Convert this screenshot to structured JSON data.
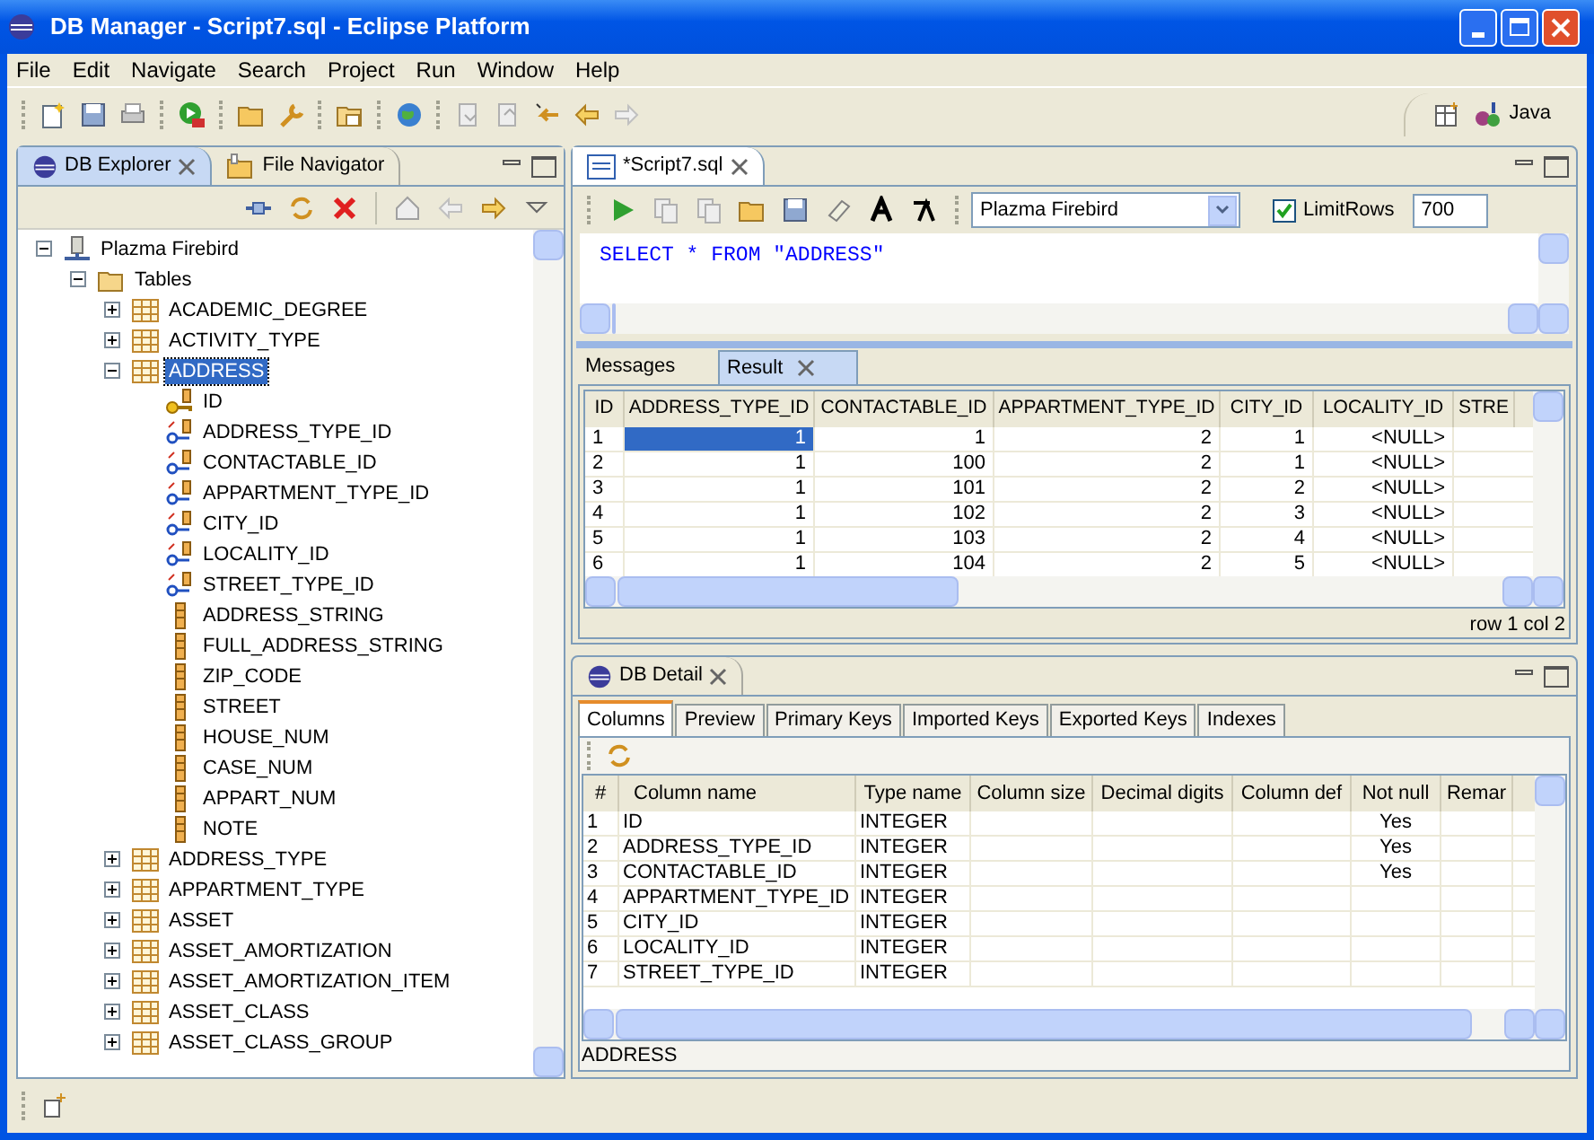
{
  "window": {
    "title": "DB Manager - Script7.sql - Eclipse Platform"
  },
  "menu": [
    "File",
    "Edit",
    "Navigate",
    "Search",
    "Project",
    "Run",
    "Window",
    "Help"
  ],
  "perspective": {
    "label": "Java"
  },
  "left_view": {
    "tabs": [
      {
        "label": "DB Explorer",
        "selected": true
      },
      {
        "label": "File Navigator",
        "selected": false
      }
    ],
    "tree": [
      {
        "label": "Plazma Firebird",
        "kind": "connection",
        "expanded": true,
        "selected": false,
        "children": [
          {
            "label": "Tables",
            "kind": "folder",
            "expanded": true,
            "selected": false,
            "children": [
              {
                "label": "ACADEMIC_DEGREE",
                "kind": "table",
                "expanded": false,
                "selected": false
              },
              {
                "label": "ACTIVITY_TYPE",
                "kind": "table",
                "expanded": false,
                "selected": false
              },
              {
                "label": "ADDRESS",
                "kind": "table",
                "expanded": true,
                "selected": true,
                "children": [
                  {
                    "label": "ID",
                    "kind": "primary_key",
                    "selected": false
                  },
                  {
                    "label": "ADDRESS_TYPE_ID",
                    "kind": "foreign_key",
                    "selected": false
                  },
                  {
                    "label": "CONTACTABLE_ID",
                    "kind": "foreign_key",
                    "selected": false
                  },
                  {
                    "label": "APPARTMENT_TYPE_ID",
                    "kind": "foreign_key",
                    "selected": false
                  },
                  {
                    "label": "CITY_ID",
                    "kind": "foreign_key",
                    "selected": false
                  },
                  {
                    "label": "LOCALITY_ID",
                    "kind": "foreign_key",
                    "selected": false
                  },
                  {
                    "label": "STREET_TYPE_ID",
                    "kind": "foreign_key",
                    "selected": false
                  },
                  {
                    "label": "ADDRESS_STRING",
                    "kind": "column",
                    "selected": false
                  },
                  {
                    "label": "FULL_ADDRESS_STRING",
                    "kind": "column",
                    "selected": false
                  },
                  {
                    "label": "ZIP_CODE",
                    "kind": "column",
                    "selected": false
                  },
                  {
                    "label": "STREET",
                    "kind": "column",
                    "selected": false
                  },
                  {
                    "label": "HOUSE_NUM",
                    "kind": "column",
                    "selected": false
                  },
                  {
                    "label": "CASE_NUM",
                    "kind": "column",
                    "selected": false
                  },
                  {
                    "label": "APPART_NUM",
                    "kind": "column",
                    "selected": false
                  },
                  {
                    "label": "NOTE",
                    "kind": "column",
                    "selected": false
                  }
                ]
              },
              {
                "label": "ADDRESS_TYPE",
                "kind": "table",
                "expanded": false,
                "selected": false
              },
              {
                "label": "APPARTMENT_TYPE",
                "kind": "table",
                "expanded": false,
                "selected": false
              },
              {
                "label": "ASSET",
                "kind": "table",
                "expanded": false,
                "selected": false
              },
              {
                "label": "ASSET_AMORTIZATION",
                "kind": "table",
                "expanded": false,
                "selected": false
              },
              {
                "label": "ASSET_AMORTIZATION_ITEM",
                "kind": "table",
                "expanded": false,
                "selected": false
              },
              {
                "label": "ASSET_CLASS",
                "kind": "table",
                "expanded": false,
                "selected": false
              },
              {
                "label": "ASSET_CLASS_GROUP",
                "kind": "table",
                "expanded": false,
                "selected": false
              }
            ]
          }
        ]
      }
    ]
  },
  "editor": {
    "tab": {
      "label": "*Script7.sql"
    },
    "connection": {
      "value": "Plazma Firebird"
    },
    "limit_rows": {
      "label": "LimitRows",
      "checked": true,
      "value": "700"
    },
    "sql": "SELECT * FROM \"ADDRESS\"",
    "result_tabs": [
      {
        "label": "Messages",
        "selected": false,
        "closable": false
      },
      {
        "label": "Result",
        "selected": true,
        "closable": true
      }
    ],
    "result_table": {
      "columns": [
        "ID",
        "ADDRESS_TYPE_ID",
        "CONTACTABLE_ID",
        "APPARTMENT_TYPE_ID",
        "CITY_ID",
        "LOCALITY_ID",
        "STRE"
      ],
      "rows": [
        [
          {
            "text": "1",
            "selected": false
          },
          {
            "text": "1",
            "selected": true
          },
          {
            "text": "1",
            "selected": false
          },
          {
            "text": "2",
            "selected": false
          },
          {
            "text": "1",
            "selected": false
          },
          {
            "text": "<NULL>",
            "selected": false
          }
        ],
        [
          {
            "text": "2",
            "selected": false
          },
          {
            "text": "1",
            "selected": false
          },
          {
            "text": "100",
            "selected": false
          },
          {
            "text": "2",
            "selected": false
          },
          {
            "text": "1",
            "selected": false
          },
          {
            "text": "<NULL>",
            "selected": false
          }
        ],
        [
          {
            "text": "3",
            "selected": false
          },
          {
            "text": "1",
            "selected": false
          },
          {
            "text": "101",
            "selected": false
          },
          {
            "text": "2",
            "selected": false
          },
          {
            "text": "2",
            "selected": false
          },
          {
            "text": "<NULL>",
            "selected": false
          }
        ],
        [
          {
            "text": "4",
            "selected": false
          },
          {
            "text": "1",
            "selected": false
          },
          {
            "text": "102",
            "selected": false
          },
          {
            "text": "2",
            "selected": false
          },
          {
            "text": "3",
            "selected": false
          },
          {
            "text": "<NULL>",
            "selected": false
          }
        ],
        [
          {
            "text": "5",
            "selected": false
          },
          {
            "text": "1",
            "selected": false
          },
          {
            "text": "103",
            "selected": false
          },
          {
            "text": "2",
            "selected": false
          },
          {
            "text": "4",
            "selected": false
          },
          {
            "text": "<NULL>",
            "selected": false
          }
        ],
        [
          {
            "text": "6",
            "selected": false
          },
          {
            "text": "1",
            "selected": false
          },
          {
            "text": "104",
            "selected": false
          },
          {
            "text": "2",
            "selected": false
          },
          {
            "text": "5",
            "selected": false
          },
          {
            "text": "<NULL>",
            "selected": false
          }
        ]
      ]
    },
    "status": "row 1 col 2"
  },
  "detail": {
    "tab": {
      "label": "DB Detail"
    },
    "tabs": [
      {
        "label": "Columns",
        "selected": true
      },
      {
        "label": "Preview",
        "selected": false
      },
      {
        "label": "Primary Keys",
        "selected": false
      },
      {
        "label": "Imported Keys",
        "selected": false
      },
      {
        "label": "Exported Keys",
        "selected": false
      },
      {
        "label": "Indexes",
        "selected": false
      }
    ],
    "columns": [
      "#",
      "Column name",
      "Type name",
      "Column size",
      "Decimal digits",
      "Column def",
      "Not null",
      "Remar"
    ],
    "rows": [
      [
        "1",
        "ID",
        "INTEGER",
        "",
        "",
        "",
        "Yes",
        ""
      ],
      [
        "2",
        "ADDRESS_TYPE_ID",
        "INTEGER",
        "",
        "",
        "",
        "Yes",
        ""
      ],
      [
        "3",
        "CONTACTABLE_ID",
        "INTEGER",
        "",
        "",
        "",
        "Yes",
        ""
      ],
      [
        "4",
        "APPARTMENT_TYPE_ID",
        "INTEGER",
        "",
        "",
        "",
        "",
        ""
      ],
      [
        "5",
        "CITY_ID",
        "INTEGER",
        "",
        "",
        "",
        "",
        ""
      ],
      [
        "6",
        "LOCALITY_ID",
        "INTEGER",
        "",
        "",
        "",
        "",
        ""
      ],
      [
        "7",
        "STREET_TYPE_ID",
        "INTEGER",
        "",
        "",
        "",
        "",
        ""
      ]
    ],
    "footer": "ADDRESS"
  }
}
